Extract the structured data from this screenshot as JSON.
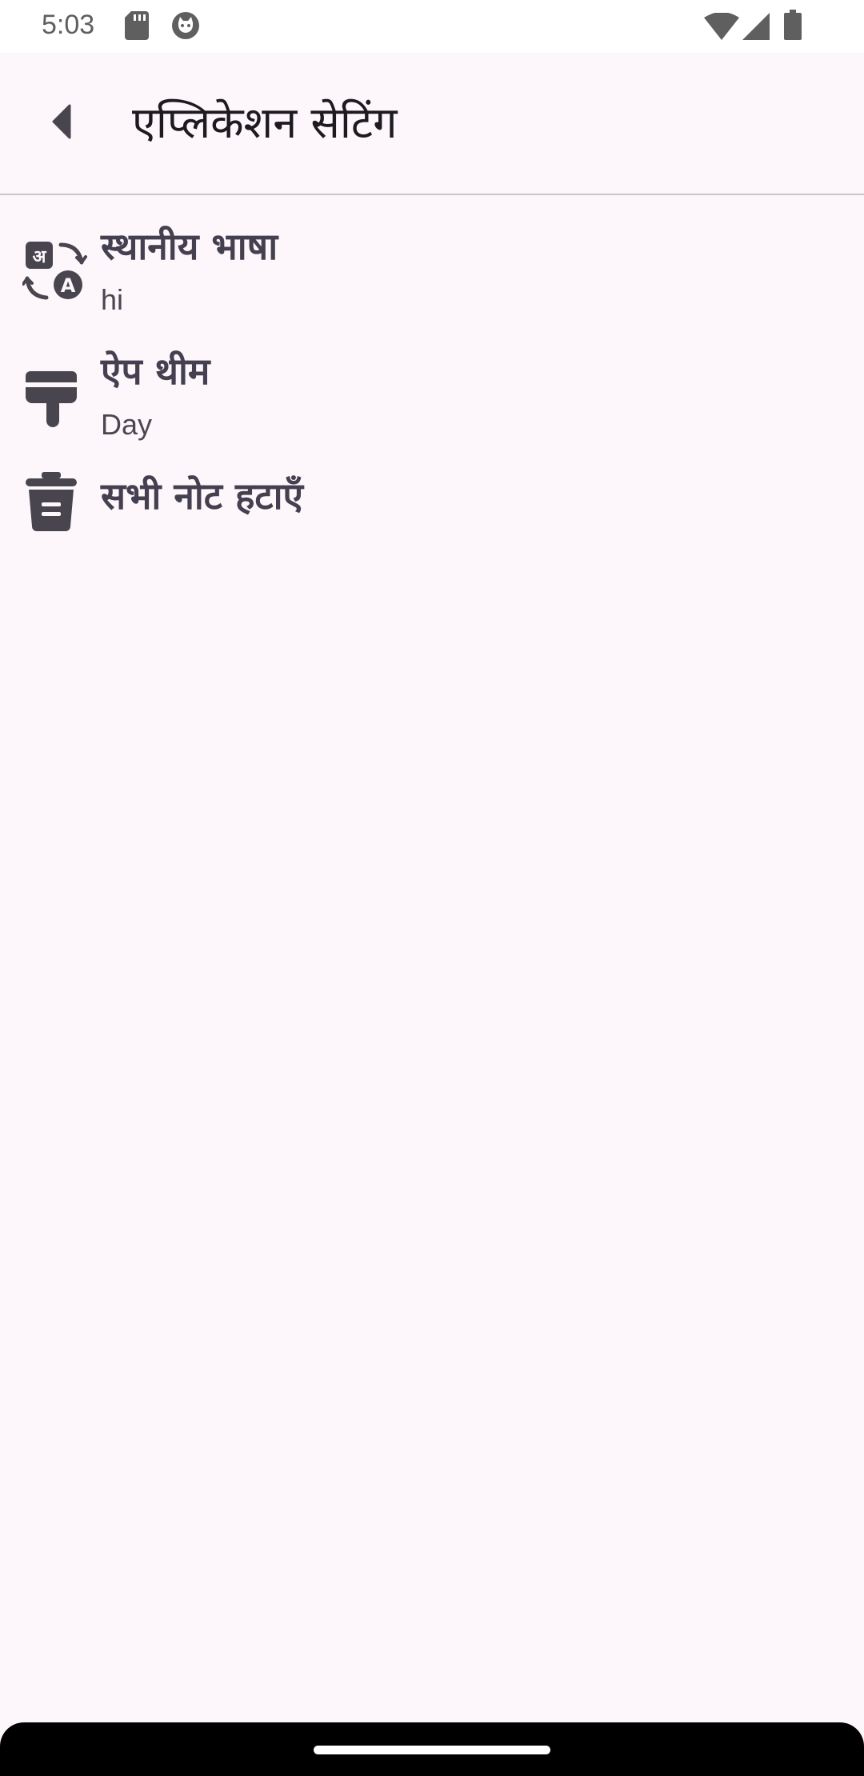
{
  "status_bar": {
    "time": "5:03",
    "left_icons": [
      "sd-card-icon",
      "cat-face-icon"
    ],
    "right_icons": [
      "wifi-icon",
      "cellular-signal-icon",
      "battery-icon"
    ]
  },
  "toolbar": {
    "back_icon": "back-arrow-icon",
    "title": "एप्लिकेशन सेटिंग"
  },
  "settings": {
    "items": [
      {
        "icon": "translate-icon",
        "title": " स्थानीय भाषा",
        "subtitle": "hi"
      },
      {
        "icon": "paint-brush-icon",
        "title": "ऐप थीम",
        "subtitle": "Day"
      },
      {
        "icon": "trash-icon",
        "title": "सभी नोट हटाएँ",
        "subtitle": ""
      }
    ]
  },
  "colors": {
    "background": "#fdf7fc",
    "icon": "#49454f",
    "title_text": "#1d1b20"
  }
}
